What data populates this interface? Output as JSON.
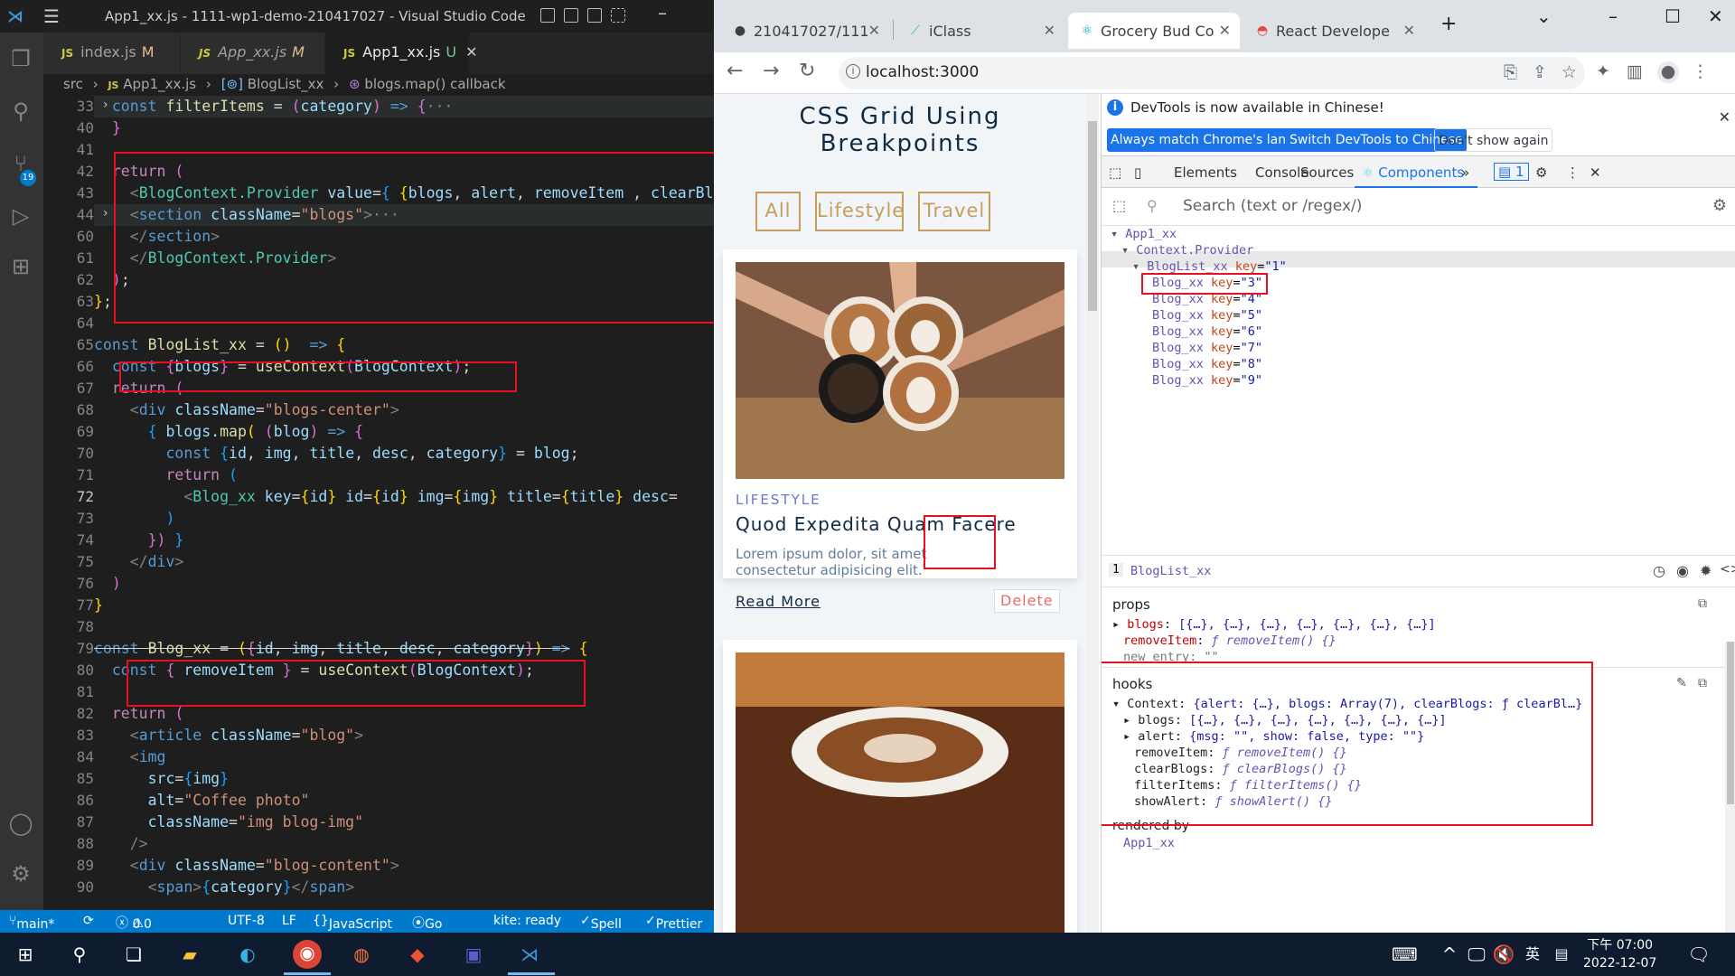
{
  "vscode": {
    "title": "App1_xx.js - 1111-wp1-demo-210417027 - Visual Studio Code",
    "tabs": [
      {
        "name": "index.js",
        "status": "M"
      },
      {
        "name": "App_xx.js",
        "status": "M"
      },
      {
        "name": "App1_xx.js",
        "status": "U"
      }
    ],
    "breadcrumb": [
      "src",
      "App1_xx.js",
      "BlogList_xx",
      "blogs.map() callback"
    ],
    "line_numbers": [
      "33",
      "40",
      "41",
      "42",
      "43",
      "44",
      "60",
      "61",
      "62",
      "63",
      "64",
      "65",
      "66",
      "67",
      "68",
      "69",
      "70",
      "71",
      "72",
      "73",
      "74",
      "75",
      "76",
      "77",
      "78",
      "79",
      "80",
      "81",
      "82",
      "83",
      "84",
      "85",
      "86",
      "87",
      "88",
      "89",
      "90"
    ],
    "status": {
      "branch": "main*",
      "problems": "0",
      "warnings": "0",
      "encoding": "UTF-8",
      "eol": "LF",
      "language": "JavaScript",
      "golive": "Go Live",
      "kite": "kite: ready",
      "spell": "Spell",
      "prettier": "Prettier"
    }
  },
  "chrome": {
    "tabs": [
      {
        "title": "210417027/111"
      },
      {
        "title": "iClass"
      },
      {
        "title": "Grocery Bud Co"
      },
      {
        "title": "React Develope"
      }
    ],
    "url": "localhost:3000"
  },
  "page": {
    "heading": "CSS Grid Using Breakpoints",
    "filters": [
      "All",
      "Lifestyle",
      "Travel"
    ],
    "card": {
      "category": "LIFESTYLE",
      "title": "Quod Expedita Quam Facere",
      "desc": "Lorem ipsum dolor, sit amet consectetur adipisicing elit.",
      "read_more": "Read More",
      "delete": "Delete"
    }
  },
  "devtools": {
    "info": "DevTools is now available in Chinese!",
    "btn_match": "Always match Chrome's language",
    "btn_switch": "Switch DevTools to Chinese",
    "btn_dont": "Don't show again",
    "tabs": [
      "Elements",
      "Console",
      "Sources",
      "Components"
    ],
    "badge": "1",
    "search_placeholder": "Search (text or /regex/)",
    "tree": [
      {
        "name": "App1_xx",
        "key": ""
      },
      {
        "name": "Context.Provider",
        "key": ""
      },
      {
        "name": "BlogList_xx",
        "key": "\"1\""
      },
      {
        "name": "Blog_xx",
        "key": "\"3\""
      },
      {
        "name": "Blog_xx",
        "key": "\"4\""
      },
      {
        "name": "Blog_xx",
        "key": "\"5\""
      },
      {
        "name": "Blog_xx",
        "key": "\"6\""
      },
      {
        "name": "Blog_xx",
        "key": "\"7\""
      },
      {
        "name": "Blog_xx",
        "key": "\"8\""
      },
      {
        "name": "Blog_xx",
        "key": "\"9\""
      }
    ],
    "selected_index": "1",
    "selected_name": "BlogList_xx",
    "props_header": "props",
    "props": [
      {
        "k": "blogs",
        "v": "[{…}, {…}, {…}, {…}, {…}, {…}, {…}]"
      },
      {
        "k": "removeItem",
        "v": "ƒ removeItem() {}"
      },
      {
        "k": "new entry",
        "v": "\"\""
      }
    ],
    "hooks_header": "hooks",
    "hooks": [
      {
        "k": "Context",
        "v": "{alert: {…}, blogs: Array(7), clearBlogs: ƒ clearBl…}"
      },
      {
        "k": "blogs",
        "v": "[{…}, {…}, {…}, {…}, {…}, {…}, {…}]"
      },
      {
        "k": "alert",
        "v": "{msg: \"\", show: false, type: \"\"}"
      },
      {
        "k": "removeItem",
        "v": "ƒ removeItem() {}"
      },
      {
        "k": "clearBlogs",
        "v": "ƒ clearBlogs() {}"
      },
      {
        "k": "filterItems",
        "v": "ƒ filterItems() {}"
      },
      {
        "k": "showAlert",
        "v": "ƒ showAlert() {}"
      }
    ],
    "rendered_by": "rendered by",
    "rendered_by_item": "App1_xx"
  },
  "taskbar": {
    "time": "下午 07:00",
    "date": "2022-12-07",
    "ime": "英"
  }
}
